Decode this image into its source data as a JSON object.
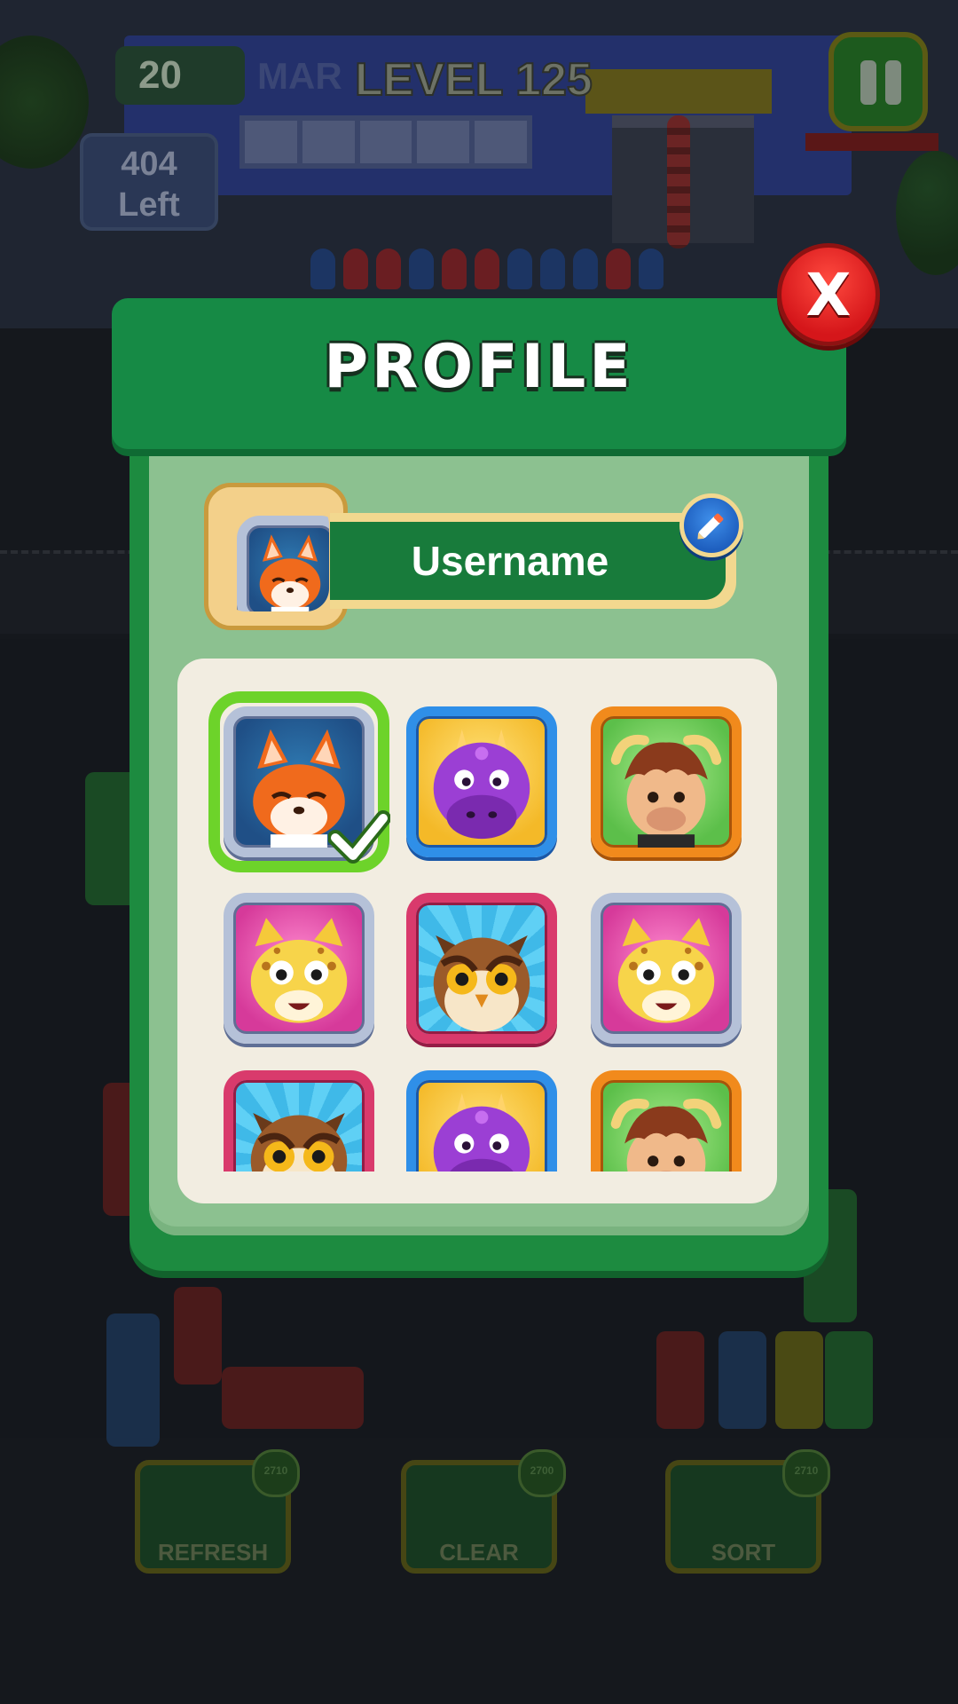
{
  "hud": {
    "coins": "20",
    "sign_text": "MAR",
    "level": "LEVEL 125",
    "remaining_count": "404",
    "remaining_label": "Left"
  },
  "boosters": [
    {
      "label": "REFRESH",
      "cost": "2710"
    },
    {
      "label": "CLEAR",
      "cost": "2700"
    },
    {
      "label": "SORT",
      "cost": "2710"
    }
  ],
  "modal": {
    "title": "PROFILE",
    "close_label": "X",
    "username": "Username",
    "current_avatar": "fox"
  },
  "avatars": [
    {
      "animal": "fox",
      "frame": "silver",
      "selected": true
    },
    {
      "animal": "dragon",
      "frame": "blue",
      "selected": false
    },
    {
      "animal": "yak",
      "frame": "orange",
      "selected": false
    },
    {
      "animal": "leopard",
      "frame": "silver",
      "selected": false
    },
    {
      "animal": "owl",
      "frame": "pink",
      "selected": false
    },
    {
      "animal": "leopard",
      "frame": "silver",
      "selected": false
    },
    {
      "animal": "owl",
      "frame": "pink",
      "selected": false
    },
    {
      "animal": "dragon",
      "frame": "blue",
      "selected": false
    },
    {
      "animal": "yak",
      "frame": "orange",
      "selected": false
    }
  ],
  "colors": {
    "modal_green": "#168a45",
    "panel_bg": "#8cc190",
    "selected_ring": "#6dd32a",
    "close_red": "#d5161a",
    "edit_blue": "#1e5fbf"
  },
  "icons": {
    "close": "close-icon",
    "edit": "pencil-icon",
    "selected": "checkmark-icon"
  }
}
